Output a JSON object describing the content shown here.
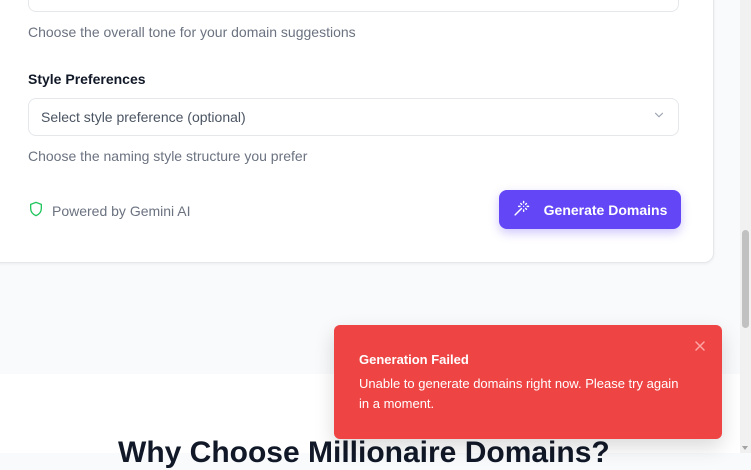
{
  "form": {
    "tone_helper": "Choose the overall tone for your domain suggestions",
    "style_label": "Style Preferences",
    "style_placeholder": "Select style preference (optional)",
    "style_helper": "Choose the naming style structure you prefer",
    "powered_by": "Powered by Gemini AI",
    "generate_button": "Generate Domains"
  },
  "section": {
    "heading": "Why Choose Millionaire Domains?"
  },
  "toast": {
    "title": "Generation Failed",
    "message": "Unable to generate domains right now. Please try again in a moment."
  },
  "icons": {
    "select_chevron": "chevron-down-icon",
    "powered": "shield-icon",
    "generate": "magic-wand-icon",
    "toast_close": "close-icon"
  },
  "colors": {
    "primary": "#6346f6",
    "toast_error": "#ef4444",
    "shield_green": "#22c55e"
  }
}
